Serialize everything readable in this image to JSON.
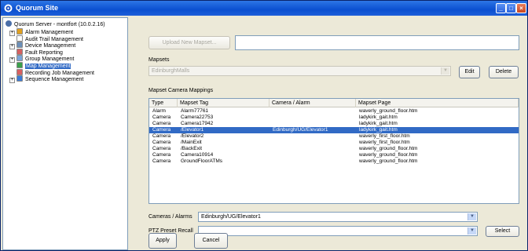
{
  "window": {
    "title": "Quorum Site",
    "controls": [
      "_",
      "□",
      "×"
    ]
  },
  "tree": {
    "root": "Quorum Server - montfort (10.0.2.16)",
    "items": [
      {
        "label": "Alarm Management",
        "expandable": true,
        "icon": "bell-icon",
        "color": "#e0a020"
      },
      {
        "label": "Audit Trail Management",
        "expandable": false,
        "icon": "document-icon",
        "color": "#ffffff"
      },
      {
        "label": "Device Management",
        "expandable": true,
        "icon": "device-icon",
        "color": "#6b8fb8"
      },
      {
        "label": "Fault Reporting",
        "expandable": false,
        "icon": "fault-icon",
        "color": "#d46060"
      },
      {
        "label": "Group Management",
        "expandable": true,
        "icon": "group-icon",
        "color": "#7aa4d8"
      },
      {
        "label": "Map Management",
        "expandable": false,
        "icon": "globe-icon",
        "color": "#3aa04a",
        "selected": true
      },
      {
        "label": "Recording Job Management",
        "expandable": false,
        "icon": "calendar-icon",
        "color": "#d86060"
      },
      {
        "label": "Sequence Management",
        "expandable": true,
        "icon": "sequence-icon",
        "color": "#3b7bd6"
      }
    ]
  },
  "upload": {
    "button": "Upload New Mapset...",
    "value": ""
  },
  "mapsets": {
    "label": "Mapsets",
    "selected": "EdinburghMalls",
    "edit": "Edit",
    "delete": "Delete"
  },
  "mappings": {
    "label": "Mapset Camera Mappings",
    "columns": [
      "Type",
      "Mapset Tag",
      "Camera / Alarm",
      "Mapset Page"
    ],
    "rows": [
      [
        "Alarm",
        "Alarm77761",
        "",
        "waverly_ground_floor.htm"
      ],
      [
        "Camera",
        "Camera22753",
        "",
        "ladykirk_gait.htm"
      ],
      [
        "Camera",
        "Camera17942",
        "",
        "ladykirk_gait.htm"
      ],
      [
        "Camera",
        "/Elevator1",
        "Edinburgh/UG/Elevator1",
        "ladykirk_gait.htm"
      ],
      [
        "Camera",
        "/Elevator2",
        "",
        "waverly_first_floor.htm"
      ],
      [
        "Camera",
        "/MainExit",
        "",
        "waverly_first_floor.htm"
      ],
      [
        "Camera",
        "/BackExit",
        "",
        "waverly_ground_floor.htm"
      ],
      [
        "Camera",
        "Camera10914",
        "",
        "waverly_ground_floor.htm"
      ],
      [
        "Camera",
        "GroundFloorATMs",
        "",
        "waverly_ground_floor.htm"
      ]
    ],
    "selected_row": 3
  },
  "cameras": {
    "label": "Cameras / Alarms",
    "value": "Edinburgh/UG/Elevator1"
  },
  "ptz": {
    "label": "PTZ Preset Recall",
    "value": "",
    "select": "Select"
  },
  "footer": {
    "apply": "Apply",
    "cancel": "Cancel"
  }
}
